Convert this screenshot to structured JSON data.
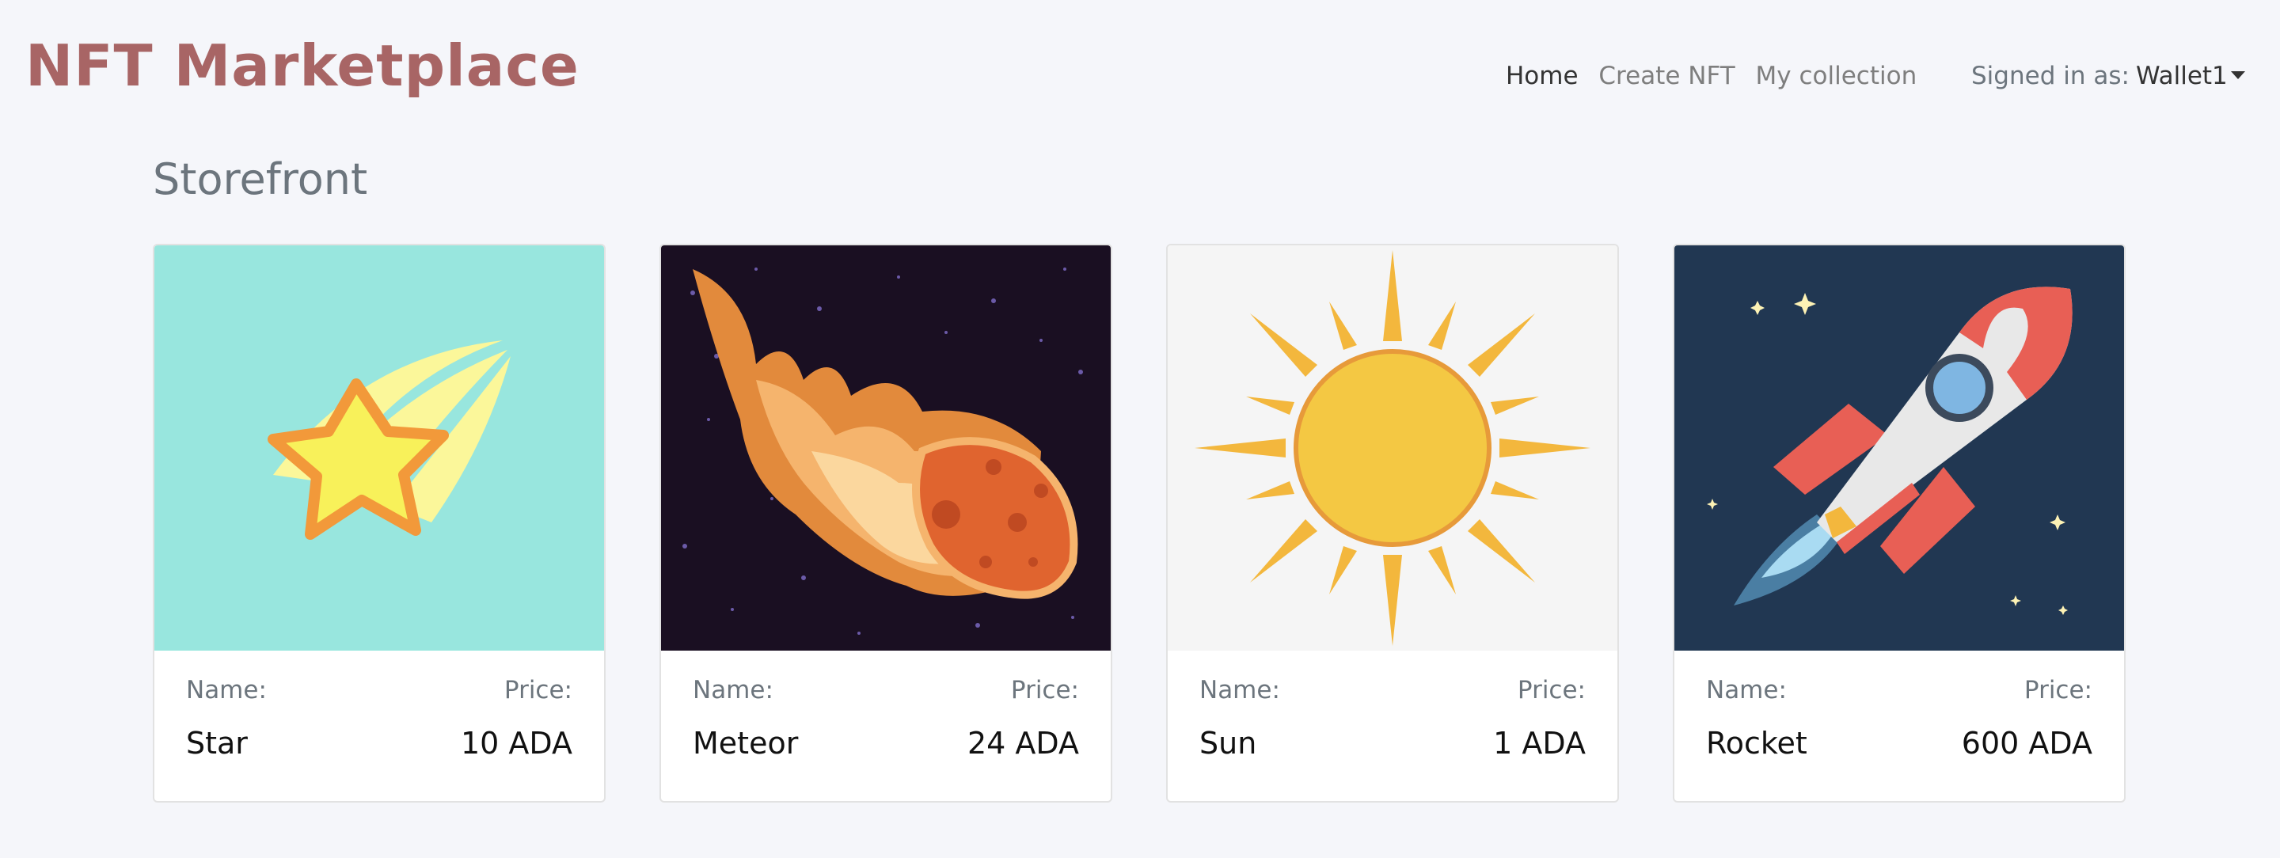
{
  "navbar": {
    "brand": "NFT Marketplace",
    "links": [
      {
        "label": "Home",
        "active": true
      },
      {
        "label": "Create NFT",
        "active": false
      },
      {
        "label": "My collection",
        "active": false
      }
    ],
    "signed_in_label": "Signed in as:",
    "wallet": "Wallet1"
  },
  "page": {
    "title": "Storefront"
  },
  "cards": [
    {
      "image_icon": "shooting-star",
      "name_label": "Name:",
      "price_label": "Price:",
      "name": "Star",
      "price": "10 ADA",
      "bg": "#98e6de"
    },
    {
      "image_icon": "meteor",
      "name_label": "Name:",
      "price_label": "Price:",
      "name": "Meteor",
      "price": "24 ADA",
      "bg": "#1a0f22"
    },
    {
      "image_icon": "sun",
      "name_label": "Name:",
      "price_label": "Price:",
      "name": "Sun",
      "price": "1 ADA",
      "bg": "#f5f5f5"
    },
    {
      "image_icon": "rocket",
      "name_label": "Name:",
      "price_label": "Price:",
      "name": "Rocket",
      "price": "600 ADA",
      "bg": "#213752"
    }
  ]
}
